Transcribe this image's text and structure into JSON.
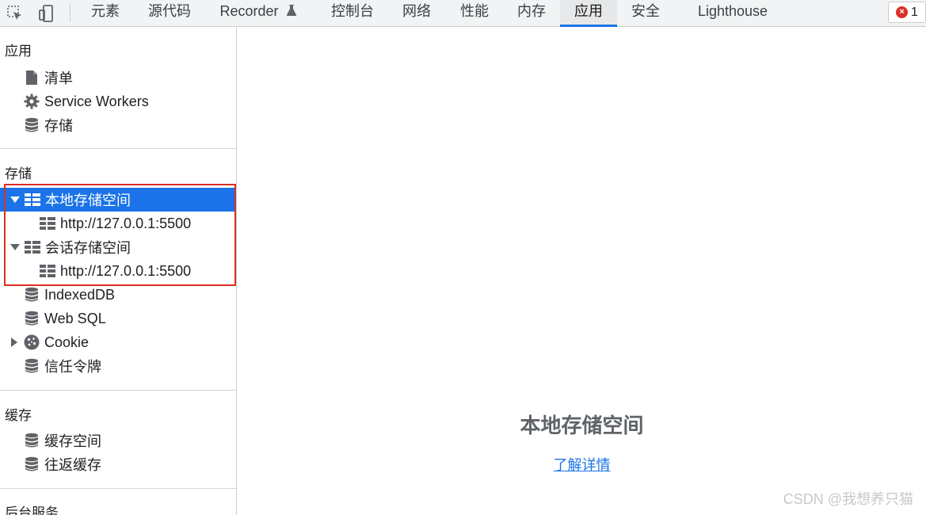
{
  "toolbar": {
    "tabs": [
      {
        "label": "元素"
      },
      {
        "label": "源代码"
      },
      {
        "label": "Recorder"
      },
      {
        "label": "控制台"
      },
      {
        "label": "网络"
      },
      {
        "label": "性能"
      },
      {
        "label": "内存"
      },
      {
        "label": "应用"
      },
      {
        "label": "安全"
      },
      {
        "label": "Lighthouse"
      }
    ],
    "active_tab": "应用",
    "error_count": "1",
    "accent_color": "#1a73e8"
  },
  "sidebar": {
    "sections": [
      {
        "title": "应用",
        "items": [
          {
            "label": "清单",
            "icon": "file-icon"
          },
          {
            "label": "Service Workers",
            "icon": "gear-icon"
          },
          {
            "label": "存储",
            "icon": "database-icon"
          }
        ]
      },
      {
        "title": "存储",
        "items": [
          {
            "label": "本地存储空间",
            "icon": "grid-icon",
            "expanded": true,
            "selected": true
          },
          {
            "label": "http://127.0.0.1:5500",
            "icon": "grid-icon"
          },
          {
            "label": "会话存储空间",
            "icon": "grid-icon",
            "expanded": true
          },
          {
            "label": "http://127.0.0.1:5500",
            "icon": "grid-icon"
          },
          {
            "label": "IndexedDB",
            "icon": "database-icon"
          },
          {
            "label": "Web SQL",
            "icon": "database-icon"
          },
          {
            "label": "Cookie",
            "icon": "cookie-icon",
            "expanded": false
          },
          {
            "label": "信任令牌",
            "icon": "database-icon"
          }
        ]
      },
      {
        "title": "缓存",
        "items": [
          {
            "label": "缓存空间",
            "icon": "database-icon"
          },
          {
            "label": "往返缓存",
            "icon": "database-icon"
          }
        ]
      },
      {
        "title": "后台服务",
        "items": []
      }
    ]
  },
  "main": {
    "title": "本地存储空间",
    "link": "了解详情"
  },
  "watermark": "CSDN @我想养只猫"
}
